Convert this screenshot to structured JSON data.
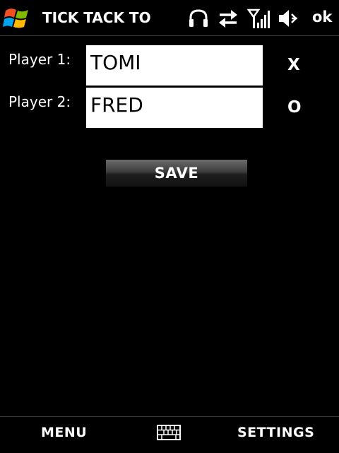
{
  "titlebar": {
    "title": "TICK TACK TO",
    "ok_label": "ok",
    "icons": [
      "windows-start-icon",
      "headset-icon",
      "data-connection-icon",
      "signal-strength-icon",
      "volume-icon"
    ]
  },
  "form": {
    "player1": {
      "label": "Player 1:",
      "value": "TOMI",
      "symbol": "X"
    },
    "player2": {
      "label": "Player 2:",
      "value": "FRED",
      "symbol": "O"
    },
    "save_label": "SAVE"
  },
  "softkeys": {
    "left_label": "MENU",
    "center_icon": "keyboard-icon",
    "right_label": "SETTINGS"
  }
}
